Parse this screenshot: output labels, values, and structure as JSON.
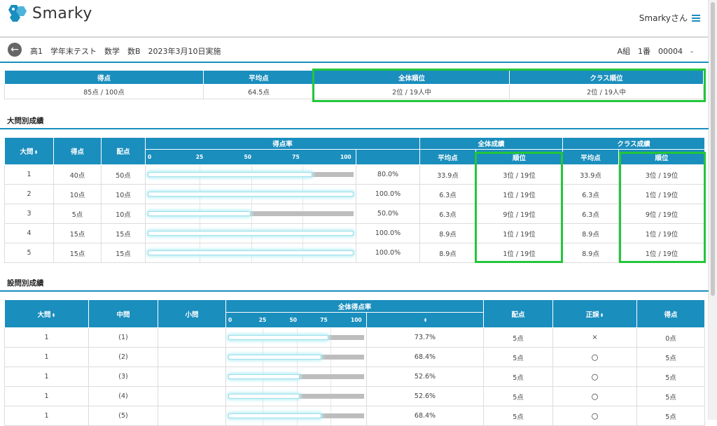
{
  "header": {
    "logo_text": "Smarky",
    "user_label": "Smarkyさん"
  },
  "subheader": {
    "title": "高1　学年末テスト　数学　数B　2023年3月10日実施",
    "meta": "A組　1番　00004　-"
  },
  "summary": {
    "headers": [
      "得点",
      "平均点",
      "全体順位",
      "クラス順位"
    ],
    "values": [
      "85点 / 100点",
      "64.5点",
      "2位 / 19人中",
      "2位 / 19人中"
    ]
  },
  "section1": {
    "title": "大問別成績",
    "headers": {
      "q": "大問",
      "score": "得点",
      "alloc": "配点",
      "rate": "得点率",
      "overall": "全体成績",
      "class": "クラス成績",
      "avg": "平均点",
      "rank": "順位",
      "sort": "⬍"
    },
    "ticks": [
      "0",
      "25",
      "50",
      "75",
      "100"
    ],
    "rows": [
      {
        "q": "1",
        "score": "40点",
        "alloc": "50点",
        "rate": 80.0,
        "rate_text": "80.0%",
        "avg": "33.9点",
        "rank": "3位 / 19位",
        "cavg": "33.9点",
        "crank": "3位 / 19位"
      },
      {
        "q": "2",
        "score": "10点",
        "alloc": "10点",
        "rate": 100.0,
        "rate_text": "100.0%",
        "avg": "6.3点",
        "rank": "1位 / 19位",
        "cavg": "6.3点",
        "crank": "1位 / 19位"
      },
      {
        "q": "3",
        "score": "5点",
        "alloc": "10点",
        "rate": 50.0,
        "rate_text": "50.0%",
        "avg": "6.3点",
        "rank": "9位 / 19位",
        "cavg": "6.3点",
        "crank": "9位 / 19位"
      },
      {
        "q": "4",
        "score": "15点",
        "alloc": "15点",
        "rate": 100.0,
        "rate_text": "100.0%",
        "avg": "8.9点",
        "rank": "1位 / 19位",
        "cavg": "8.9点",
        "crank": "1位 / 19位"
      },
      {
        "q": "5",
        "score": "15点",
        "alloc": "15点",
        "rate": 100.0,
        "rate_text": "100.0%",
        "avg": "8.9点",
        "rank": "1位 / 19位",
        "cavg": "8.9点",
        "crank": "1位 / 19位"
      }
    ]
  },
  "section2": {
    "title": "設問別成績",
    "headers": {
      "q": "大問",
      "mid": "中問",
      "small": "小問",
      "rate": "全体得点率",
      "alloc": "配点",
      "correct": "正誤",
      "score": "得点",
      "sort": "⬍"
    },
    "ticks": [
      "0",
      "25",
      "50",
      "75",
      "100"
    ],
    "rows": [
      {
        "q": "1",
        "mid": "(1)",
        "small": "",
        "rate": 73.7,
        "rate_text": "73.7%",
        "alloc": "5点",
        "correct": "×",
        "score": "0点"
      },
      {
        "q": "1",
        "mid": "(2)",
        "small": "",
        "rate": 68.4,
        "rate_text": "68.4%",
        "alloc": "5点",
        "correct": "〇",
        "score": "5点"
      },
      {
        "q": "1",
        "mid": "(3)",
        "small": "",
        "rate": 52.6,
        "rate_text": "52.6%",
        "alloc": "5点",
        "correct": "〇",
        "score": "5点"
      },
      {
        "q": "1",
        "mid": "(4)",
        "small": "",
        "rate": 52.6,
        "rate_text": "52.6%",
        "alloc": "5点",
        "correct": "〇",
        "score": "5点"
      },
      {
        "q": "1",
        "mid": "(5)",
        "small": "",
        "rate": 68.4,
        "rate_text": "68.4%",
        "alloc": "5点",
        "correct": "〇",
        "score": "5点"
      }
    ]
  },
  "colors": {
    "accent": "#1a8ebd",
    "highlight": "#22c63a",
    "bar_track": "#bdbdbd",
    "bar_glow": "#b9eff5"
  },
  "icons": {
    "logo": "smarky-logo-icon",
    "menu": "hamburger-menu-icon",
    "back": "back-arrow-icon"
  }
}
